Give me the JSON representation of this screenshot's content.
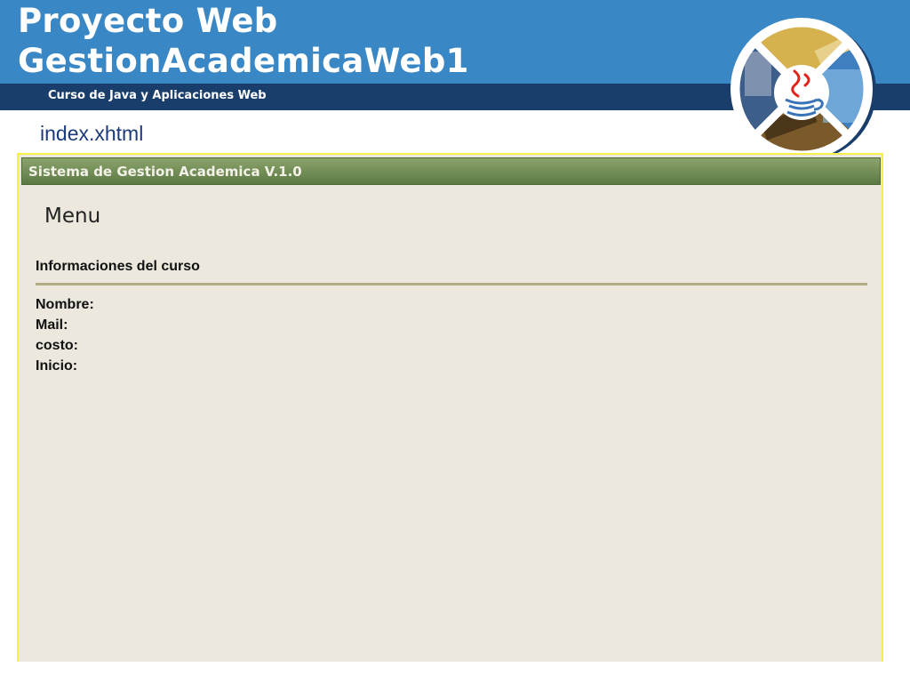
{
  "header": {
    "title_line1": "Proyecto Web",
    "title_line2": "GestionAcademicaWeb1",
    "subtitle": "Curso de Java y Aplicaciones Web"
  },
  "filename": "index.xhtml",
  "app": {
    "title": "Sistema de Gestion Academica V.1.0",
    "menu_label": "Menu",
    "section_title": "Informaciones del curso",
    "fields": [
      {
        "label": "Nombre:"
      },
      {
        "label": "Mail:"
      },
      {
        "label": "costo:"
      },
      {
        "label": "Inicio:"
      }
    ]
  },
  "colors": {
    "header_blue": "#3a87c6",
    "subtitle_band": "#1a3e6b",
    "app_bar_green": "#6f8a55",
    "panel_bg": "#ece8de",
    "frame_yellow": "#f5f04a"
  },
  "logo": {
    "icon": "java-logo-icon"
  }
}
